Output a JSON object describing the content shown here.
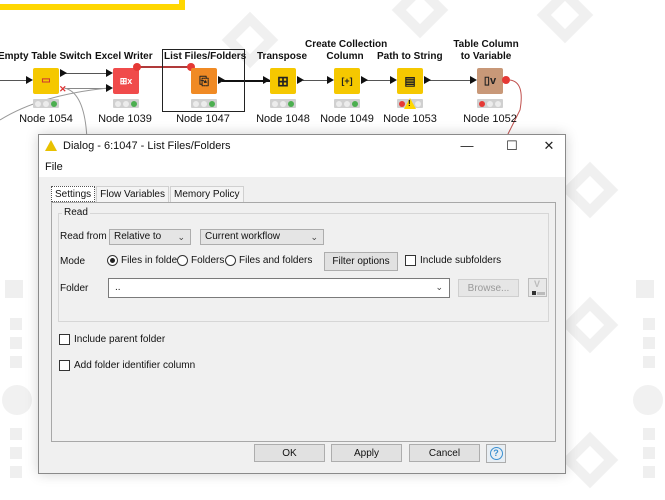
{
  "workflow": {
    "nodes": [
      {
        "title": "Empty Table Switch",
        "label": "Node 1054",
        "color": "#f5c800",
        "icon": "switch-icon",
        "lights": [
          "off",
          "off",
          "green"
        ]
      },
      {
        "title": "Excel Writer",
        "label": "Node 1039",
        "color": "#f04b4b",
        "icon": "excel-icon",
        "lights": [
          "off",
          "off",
          "green"
        ]
      },
      {
        "title": "List Files/Folders",
        "label": "Node 1047",
        "color": "#f08a24",
        "icon": "list-files-icon",
        "lights": [
          "off",
          "off",
          "green"
        ],
        "selected": true
      },
      {
        "title": "Transpose",
        "label": "Node 1048",
        "color": "#f5c800",
        "icon": "transpose-icon",
        "lights": [
          "off",
          "off",
          "green"
        ]
      },
      {
        "title_line1": "Create Collection",
        "title_line2": "Column",
        "label": "Node 1049",
        "color": "#f5c800",
        "icon": "collection-icon",
        "lights": [
          "off",
          "off",
          "green"
        ]
      },
      {
        "title": "Path to String",
        "label": "Node 1053",
        "color": "#f5c800",
        "icon": "path-icon",
        "lights": [
          "red",
          "warning",
          "off"
        ]
      },
      {
        "title_line1": "Table Column",
        "title_line2": "to Variable",
        "label": "Node 1052",
        "color": "#c89878",
        "icon": "variable-icon",
        "lights": [
          "red",
          "off",
          "off"
        ]
      }
    ],
    "icons": {
      "switch": "▭",
      "excel": "⊞x",
      "list_files": "⎘",
      "transpose": "⊞",
      "collection": "[+]",
      "path": "▤",
      "variable": "▯v",
      "warning_mark": "!"
    }
  },
  "dialog": {
    "title": "Dialog - 6:1047 - List Files/Folders",
    "window_buttons": {
      "minimize": "—",
      "maximize": "☐",
      "close": "✕"
    },
    "menu": {
      "file": "File"
    },
    "tabs": [
      {
        "label": "Settings",
        "active": true
      },
      {
        "label": "Flow Variables",
        "active": false
      },
      {
        "label": "Memory Policy",
        "active": false
      }
    ],
    "read_group": {
      "legend": "Read",
      "read_from_label": "Read from",
      "read_from_value": "Relative to",
      "relative_value": "Current workflow",
      "mode_label": "Mode",
      "mode_options": [
        {
          "label": "Files in folder",
          "selected": true
        },
        {
          "label": "Folders",
          "selected": false
        },
        {
          "label": "Files and folders",
          "selected": false
        }
      ],
      "filter_options_label": "Filter options",
      "include_subfolders_label": "Include subfolders",
      "include_subfolders_checked": false,
      "folder_label": "Folder",
      "folder_value": "..",
      "browse_label": "Browse..."
    },
    "include_parent_folder_label": "Include parent folder",
    "include_parent_folder_checked": false,
    "add_folder_identifier_label": "Add folder identifier column",
    "add_folder_identifier_checked": false,
    "buttons": {
      "ok": "OK",
      "apply": "Apply",
      "cancel": "Cancel",
      "help": "?"
    },
    "chevron": "⌄"
  }
}
